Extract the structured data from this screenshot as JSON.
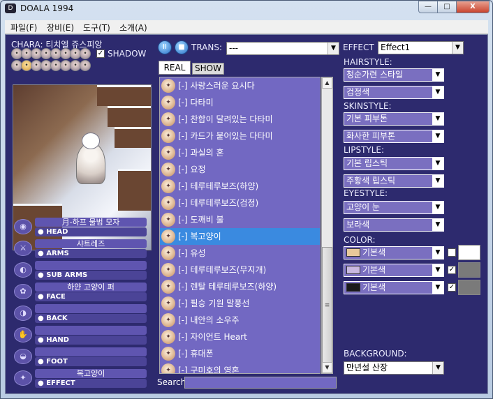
{
  "window": {
    "title": "DOALA 1994",
    "app_icon": "doala-app-icon",
    "controls": {
      "minimize": "—",
      "maximize": "□",
      "close": "X"
    }
  },
  "menu": [
    "파일(F)",
    "장비(E)",
    "도구(T)",
    "소개(A)"
  ],
  "chara": {
    "label": "CHARA: 티치엘 쥬스피앙",
    "shadow_label": "SHADOW",
    "shadow_checked": true,
    "faces_row1": [
      "face",
      "face",
      "face",
      "face",
      "face",
      "face",
      "face",
      "face"
    ],
    "faces_row2": [
      "face",
      "face",
      "face",
      "face",
      "face",
      "face",
      "face",
      "face"
    ]
  },
  "slots": [
    {
      "name": "月-하프 물범 모자",
      "type": "● HEAD"
    },
    {
      "name": "샤트레즈",
      "type": "● ARMS"
    },
    {
      "name": "",
      "type": "● SUB ARMS"
    },
    {
      "name": "하얀 고양이 퍼",
      "type": "● FACE"
    },
    {
      "name": "",
      "type": "● BACK"
    },
    {
      "name": "",
      "type": "● HAND"
    },
    {
      "name": "",
      "type": "● FOOT"
    },
    {
      "name": "복고양이",
      "type": "● EFFECT"
    }
  ],
  "playback": {
    "pause_icon": "II",
    "stop_icon": "■"
  },
  "trans": {
    "label": "TRANS:",
    "value": "---"
  },
  "tabs": {
    "real": "REAL",
    "show": "SHOW"
  },
  "items": [
    {
      "prefix": "[-]",
      "name": "사랑스러운 요시다"
    },
    {
      "prefix": "[-]",
      "name": "다타미"
    },
    {
      "prefix": "[-]",
      "name": "찬합이 달려있는 다타미"
    },
    {
      "prefix": "[-]",
      "name": "카드가 붙어있는 다타미"
    },
    {
      "prefix": "[-]",
      "name": "과실의 혼"
    },
    {
      "prefix": "[-]",
      "name": "요정"
    },
    {
      "prefix": "[-]",
      "name": "테루테루보즈(하양)"
    },
    {
      "prefix": "[-]",
      "name": "테루테루보즈(검정)"
    },
    {
      "prefix": "[-]",
      "name": "도깨비 불"
    },
    {
      "prefix": "[-]",
      "name": "복고양이",
      "selected": true
    },
    {
      "prefix": "[-]",
      "name": "유성"
    },
    {
      "prefix": "[-]",
      "name": "테루테루보즈(무지개)"
    },
    {
      "prefix": "[-]",
      "name": "렌탈 테루테루보즈(하양)"
    },
    {
      "prefix": "[-]",
      "name": "필승 기원 말풍선"
    },
    {
      "prefix": "[-]",
      "name": "내안의 소우주"
    },
    {
      "prefix": "[-]",
      "name": "자이언트 Heart"
    },
    {
      "prefix": "[-]",
      "name": "휴대폰"
    },
    {
      "prefix": "[-]",
      "name": "구미호의 영혼"
    }
  ],
  "search": {
    "label": "Search",
    "value": ""
  },
  "effect": {
    "label": "EFFECT",
    "value": "Effect1"
  },
  "hairstyle": {
    "label": "HAIRSTYLE:",
    "style": "청순가련 스타일",
    "color": "검정색"
  },
  "skinstyle": {
    "label": "SKINSTYLE:",
    "style": "기본 피부톤",
    "color": "화사한 피부톤"
  },
  "lipstyle": {
    "label": "LIPSTYLE:",
    "style": "기본 립스틱",
    "color": "주황색 립스틱"
  },
  "eyestyle": {
    "label": "EYESTYLE:",
    "style": "고양이 눈",
    "color": "보라색"
  },
  "color": {
    "label": "COLOR:",
    "rows": [
      {
        "value": "기본색",
        "swatch": "#e8c99a",
        "checked": false,
        "box": "#ffffff"
      },
      {
        "value": "기본색",
        "swatch": "#c9b9e0",
        "checked": true,
        "box": "#7a7a7a"
      },
      {
        "value": "기본색",
        "swatch": "#1a1a1a",
        "checked": true,
        "box": "#7a7a7a"
      }
    ]
  },
  "background": {
    "label": "BACKGROUND:",
    "value": "만년설 산장"
  }
}
